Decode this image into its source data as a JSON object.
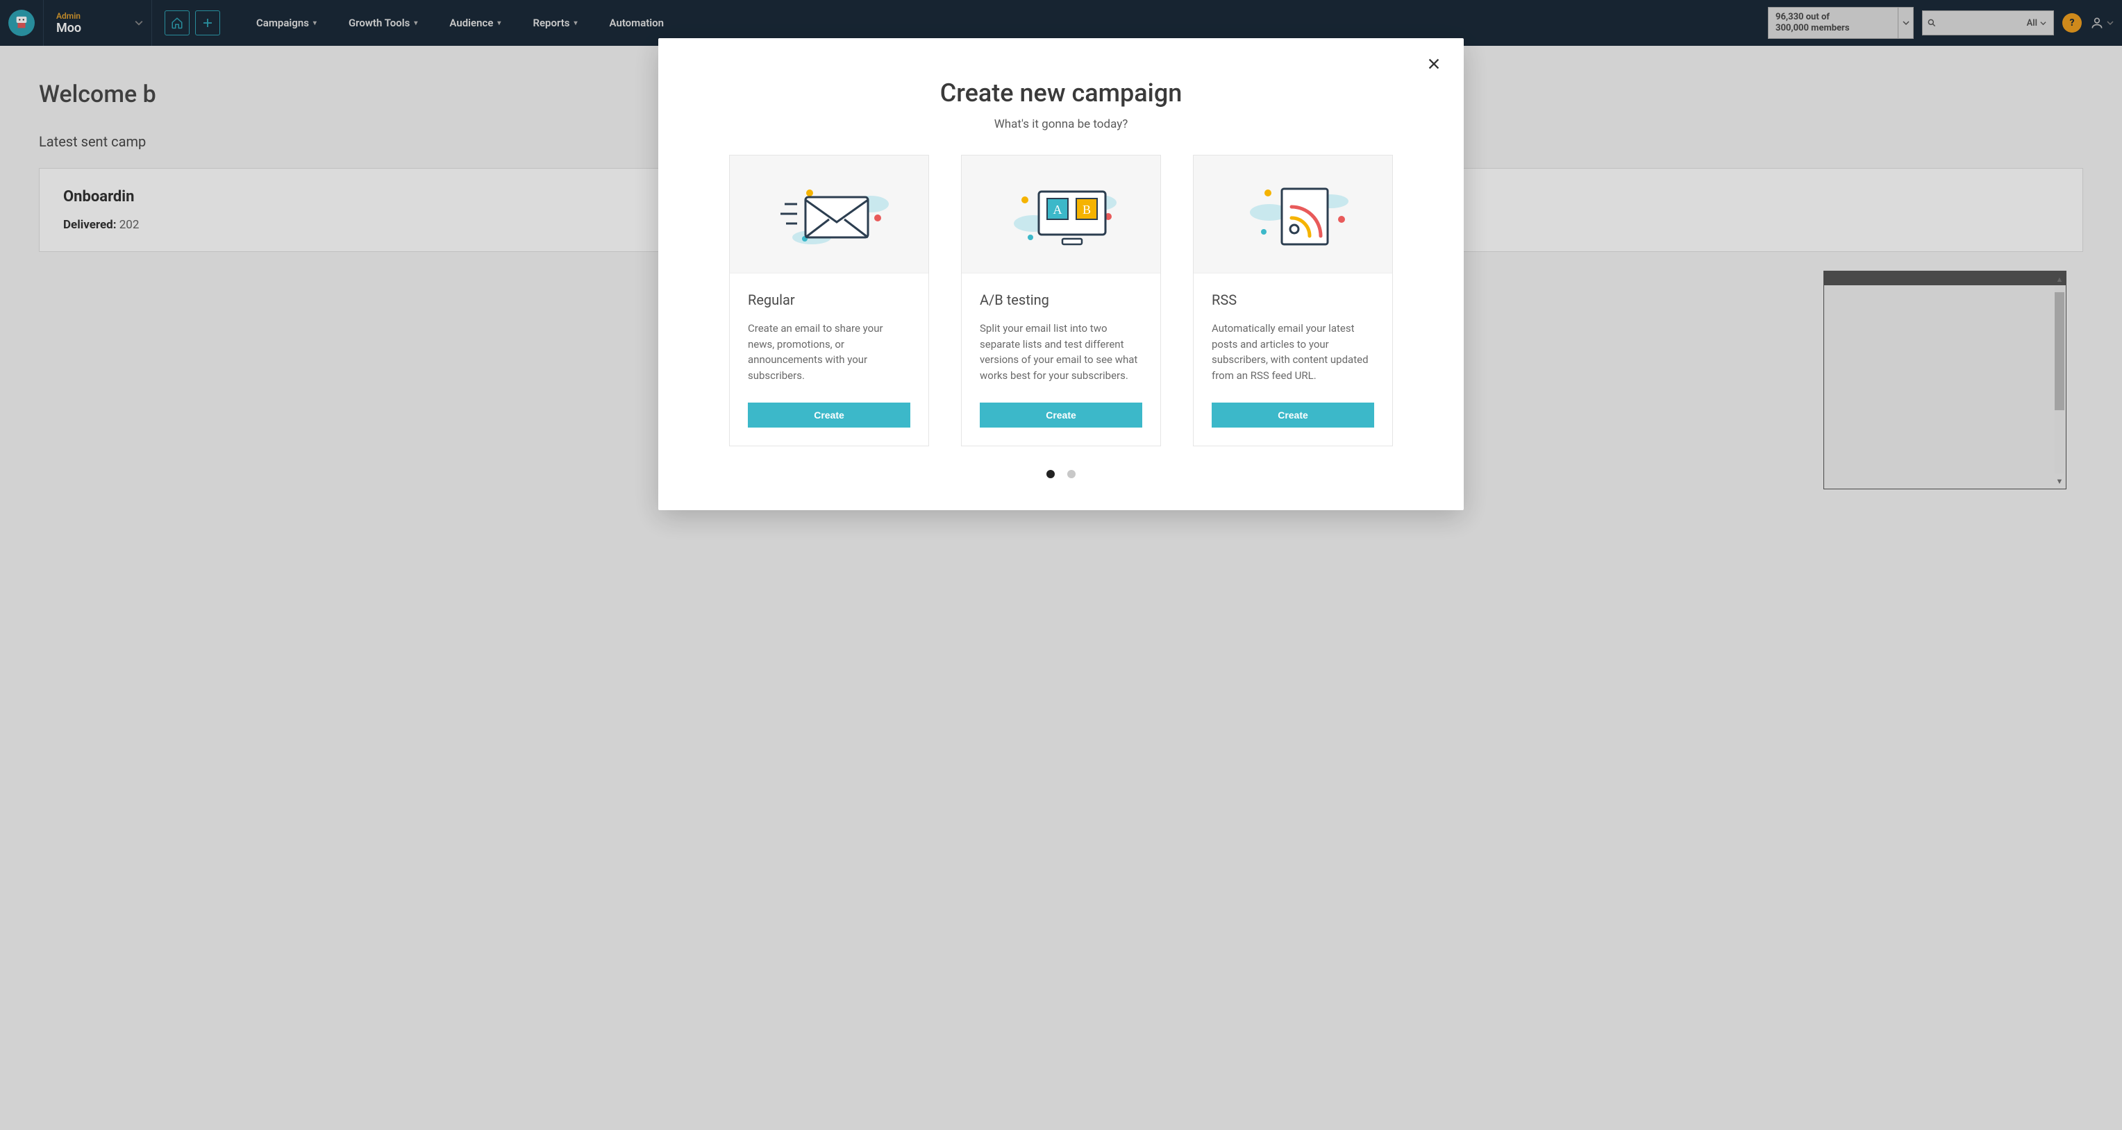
{
  "account": {
    "role": "Admin",
    "name": "Moo"
  },
  "nav": {
    "campaigns": "Campaigns",
    "growth": "Growth Tools",
    "audience": "Audience",
    "reports": "Reports",
    "automation": "Automation"
  },
  "members": {
    "line1": "96,330 out of",
    "line2": "300,000 members"
  },
  "search": {
    "filter": "All"
  },
  "help": "?",
  "bg": {
    "welcome": "Welcome b",
    "latest": "Latest sent camp",
    "card_title": "Onboardin",
    "delivered_label": "Delivered:",
    "delivered_value": "202"
  },
  "modal": {
    "title": "Create new campaign",
    "subtitle": "What's it gonna be today?",
    "cards": [
      {
        "title": "Regular",
        "desc": "Create an email to share your news, promotions, or announcements with your subscribers.",
        "button": "Create"
      },
      {
        "title": "A/B testing",
        "desc": "Split your email list into two separate lists and test different versions of your email to see what works best for your subscribers.",
        "button": "Create"
      },
      {
        "title": "RSS",
        "desc": "Automatically email your latest posts and articles to your subscribers, with content updated from an RSS feed URL.",
        "button": "Create"
      }
    ]
  }
}
